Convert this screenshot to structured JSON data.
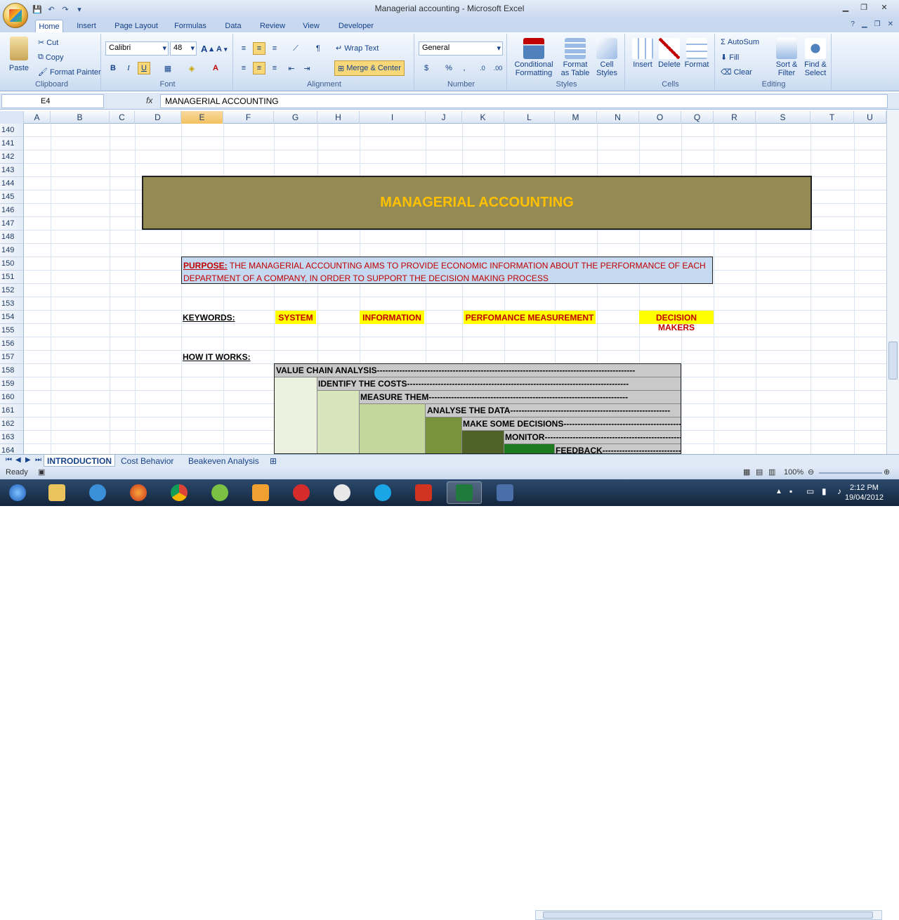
{
  "window": {
    "title": "Managerial accounting - Microsoft Excel"
  },
  "tabs": [
    "Home",
    "Insert",
    "Page Layout",
    "Formulas",
    "Data",
    "Review",
    "View",
    "Developer"
  ],
  "ribbon": {
    "clipboard": {
      "paste": "Paste",
      "cut": "Cut",
      "copy": "Copy",
      "format_painter": "Format Painter",
      "label": "Clipboard"
    },
    "font": {
      "name": "Calibri",
      "size": "48",
      "label": "Font"
    },
    "alignment": {
      "wrap": "Wrap Text",
      "merge": "Merge & Center",
      "label": "Alignment"
    },
    "number": {
      "format": "General",
      "label": "Number"
    },
    "styles": {
      "cond": "Conditional",
      "cond2": "Formatting",
      "fat": "Format",
      "fat2": "as Table",
      "cell": "Cell",
      "cell2": "Styles",
      "label": "Styles"
    },
    "cells": {
      "insert": "Insert",
      "delete": "Delete",
      "format": "Format",
      "label": "Cells"
    },
    "editing": {
      "autosum": "AutoSum",
      "fill": "Fill",
      "clear": "Clear",
      "sort": "Sort &",
      "sort2": "Filter",
      "find": "Find &",
      "find2": "Select",
      "label": "Editing"
    }
  },
  "formula_bar": {
    "name_box": "E4",
    "fx": "fx",
    "content": "MANAGERIAL ACCOUNTING"
  },
  "columns": [
    "A",
    "B",
    "C",
    "D",
    "E",
    "F",
    "G",
    "H",
    "I",
    "J",
    "K",
    "L",
    "M",
    "N",
    "O",
    "Q",
    "R",
    "S",
    "T",
    "U"
  ],
  "rows": [
    "140",
    "141",
    "142",
    "143",
    "144",
    "145",
    "146",
    "147",
    "148",
    "149",
    "150",
    "151",
    "152",
    "153",
    "154",
    "155",
    "156",
    "157",
    "158",
    "159",
    "160",
    "161",
    "162",
    "163",
    "164"
  ],
  "sheet": {
    "title": "MANAGERIAL ACCOUNTING",
    "purpose_label": "PURPOSE:",
    "purpose_text": " THE MANAGERIAL ACCOUNTING AIMS TO PROVIDE ECONOMIC INFORMATION ABOUT THE PERFORMANCE OF EACH DEPARTMENT OF A COMPANY, IN ORDER TO SUPPORT THE DECISION MAKING PROCESS",
    "keywords_label": "KEYWORDS:",
    "keywords": [
      "SYSTEM",
      "INFORMATION",
      "PERFOMANCE MEASUREMENT",
      "DECISION MAKERS"
    ],
    "how_label": "HOW IT WORKS:",
    "steps": [
      "VALUE CHAIN ANALYSIS--------------------------------------------------------------------------------------------",
      "IDENTIFY THE COSTS-------------------------------------------------------------------------------",
      "MEASURE THEM-----------------------------------------------------------------------",
      "ANALYSE THE DATA---------------------------------------------------------",
      "MAKE SOME DECISIONS-------------------------------------------",
      "MONITOR---------------------------------------------------",
      "FEEDBACK----------------------------------------"
    ]
  },
  "sheet_tabs": [
    "INTRODUCTION",
    "Cost Behavior",
    "Beakeven Analysis"
  ],
  "status": {
    "ready": "Ready",
    "zoom": "100%"
  },
  "clock": {
    "time": "2:12 PM",
    "date": "19/04/2012"
  }
}
